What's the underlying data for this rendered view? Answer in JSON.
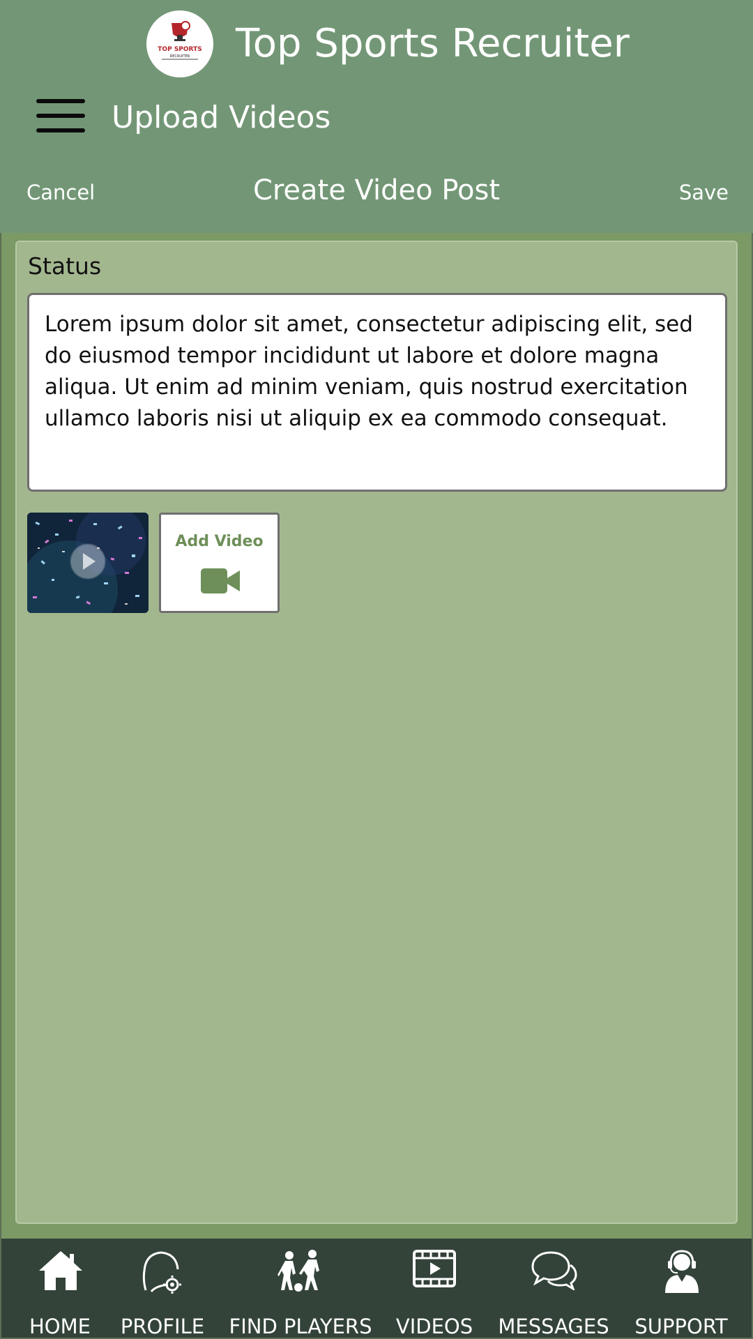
{
  "app": {
    "title": "Top Sports Recruiter",
    "logo_text": "TOP SPORTS RECRUITER"
  },
  "header": {
    "page_title": "Upload Videos",
    "menu_icon": "hamburger-menu-icon"
  },
  "toolbar": {
    "cancel_label": "Cancel",
    "title": "Create Video Post",
    "save_label": "Save"
  },
  "status": {
    "label": "Status",
    "value": "Lorem ipsum dolor sit amet, consectetur adipiscing elit, sed do eiusmod tempor incididunt ut labore et dolore magna aliqua. Ut enim ad minim veniam, quis nostrud exercitation ullamco laboris nisi ut aliquip ex ea commodo consequat."
  },
  "media": {
    "add_video_label": "Add Video",
    "add_video_icon": "video-camera-icon",
    "thumbnail_icon": "play-icon"
  },
  "nav": {
    "items": [
      {
        "label": "HOME",
        "icon": "home-icon"
      },
      {
        "label": "PROFILE",
        "icon": "profile-settings-icon"
      },
      {
        "label": "FIND PLAYERS",
        "icon": "players-icon"
      },
      {
        "label": "VIDEOS",
        "icon": "film-icon"
      },
      {
        "label": "MESSAGES",
        "icon": "chat-bubbles-icon"
      },
      {
        "label": "SUPPORT",
        "icon": "headset-agent-icon"
      }
    ]
  },
  "colors": {
    "header_bg": "#739776",
    "panel_bg": "#a3b78f",
    "accent": "#6e8f59",
    "nav_bg": "#334339"
  }
}
